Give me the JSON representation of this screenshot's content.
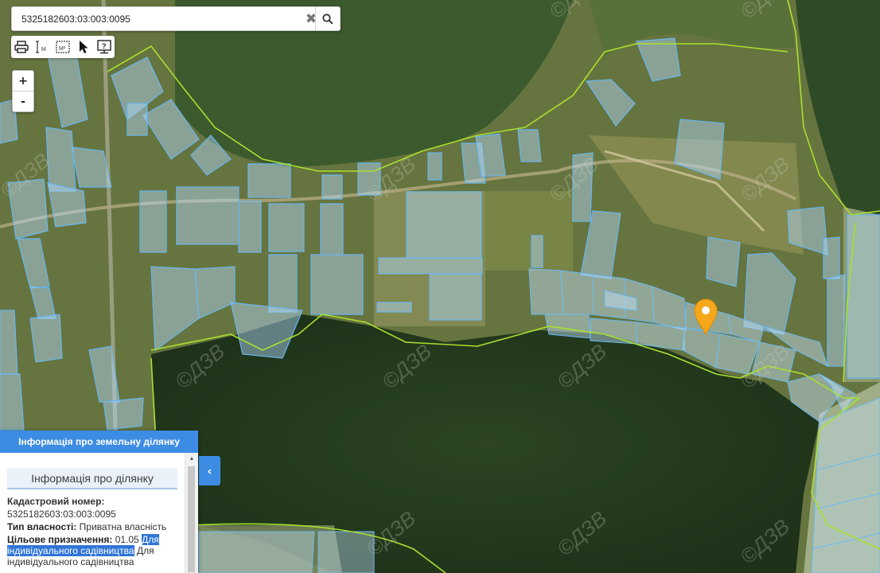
{
  "search": {
    "value": "5325182603:03:003:0095",
    "clear_icon": "times-icon",
    "search_icon": "magnifier-icon"
  },
  "toolbar": {
    "tools": [
      "printer-icon",
      "ruler-length-icon",
      "ruler-area-icon",
      "cursor-arrow-icon",
      "help-monitor-icon"
    ],
    "length_label": "M",
    "area_label": "M²",
    "help_label": "?"
  },
  "zoom": {
    "in_label": "+",
    "out_label": "-"
  },
  "map": {
    "watermark": "©ДЗВ",
    "colors": {
      "forest": "#243a1e",
      "field": "#6f7a46",
      "parcel_fill": "#b4dcff",
      "parcel_stroke": "#69b6ee",
      "boundary": "#a9e02e",
      "marker": "#f5a81c"
    },
    "marker_icon": "map-marker-icon"
  },
  "panel": {
    "header": "Інформація про земельну ділянку",
    "section_title": "Інформація про ділянку",
    "cadastral_label": "Кадастровий номер:",
    "cadastral_value": "5325182603:03:003:0095",
    "ownership_label": "Тип власності:",
    "ownership_value": "Приватна власність",
    "purpose_label": "Цільове призначення:",
    "purpose_code": "01.05",
    "purpose_highlight_1": "Для",
    "purpose_highlight_2": "індивідуального садівництва",
    "purpose_tail_1": "Для",
    "purpose_tail_2": "індивідуального садівництва",
    "toggle_icon": "chevron-left-icon",
    "scroll_up_icon": "triangle-up-icon"
  }
}
